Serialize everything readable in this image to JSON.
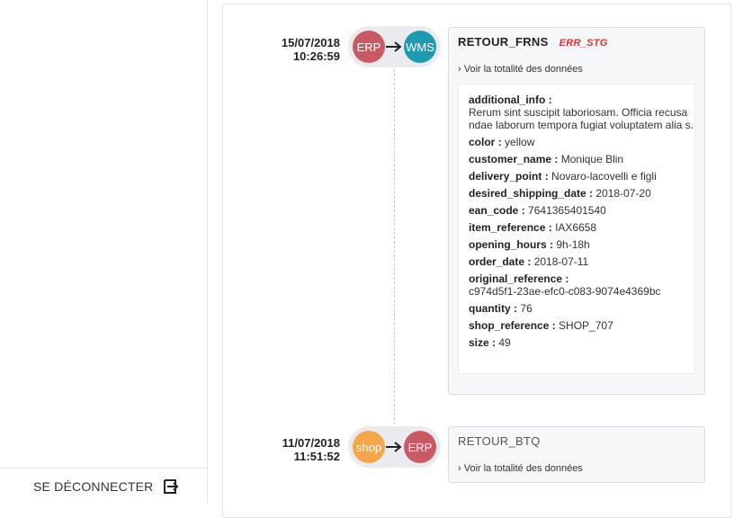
{
  "sidebar": {
    "logout_label": "SE DÉCONNECTER"
  },
  "events": [
    {
      "date": "15/07/2018",
      "time": "10:26:59",
      "from": "ERP",
      "to": "WMS",
      "title": "RETOUR_FRNS",
      "badge": "ERR_STG",
      "toggle_label": "› Voir la totalité des données",
      "fields": [
        {
          "key": "additional_info :",
          "value": "Rerum sint suscipit laboriosam. Officia recusa ndae laborum tempora fugiat voluptatem alia s."
        },
        {
          "key": "color :",
          "value": "yellow"
        },
        {
          "key": "customer_name :",
          "value": "Monique Blin"
        },
        {
          "key": "delivery_point :",
          "value": "Novaro-lacovelli e figli"
        },
        {
          "key": "desired_shipping_date :",
          "value": "2018-07-20"
        },
        {
          "key": "ean_code :",
          "value": "7641365401540"
        },
        {
          "key": "item_reference :",
          "value": "IAX6658"
        },
        {
          "key": "opening_hours :",
          "value": "9h-18h"
        },
        {
          "key": "order_date :",
          "value": "2018-07-11"
        },
        {
          "key": "original_reference :",
          "value": "c974d5f1-23ae-efc0-c083-9074e4369bc"
        },
        {
          "key": "quantity :",
          "value": "76"
        },
        {
          "key": "shop_reference :",
          "value": "SHOP_707"
        },
        {
          "key": "size :",
          "value": "49"
        }
      ]
    },
    {
      "date": "11/07/2018",
      "time": "11:51:52",
      "from": "shop",
      "to": "ERP",
      "title": "RETOUR_BTQ",
      "toggle_label": "› Voir la totalité des données"
    }
  ],
  "colors": {
    "erp": "#c95a63",
    "wms": "#1e9bb0",
    "shop": "#f5a54a",
    "error": "#d9342b"
  }
}
